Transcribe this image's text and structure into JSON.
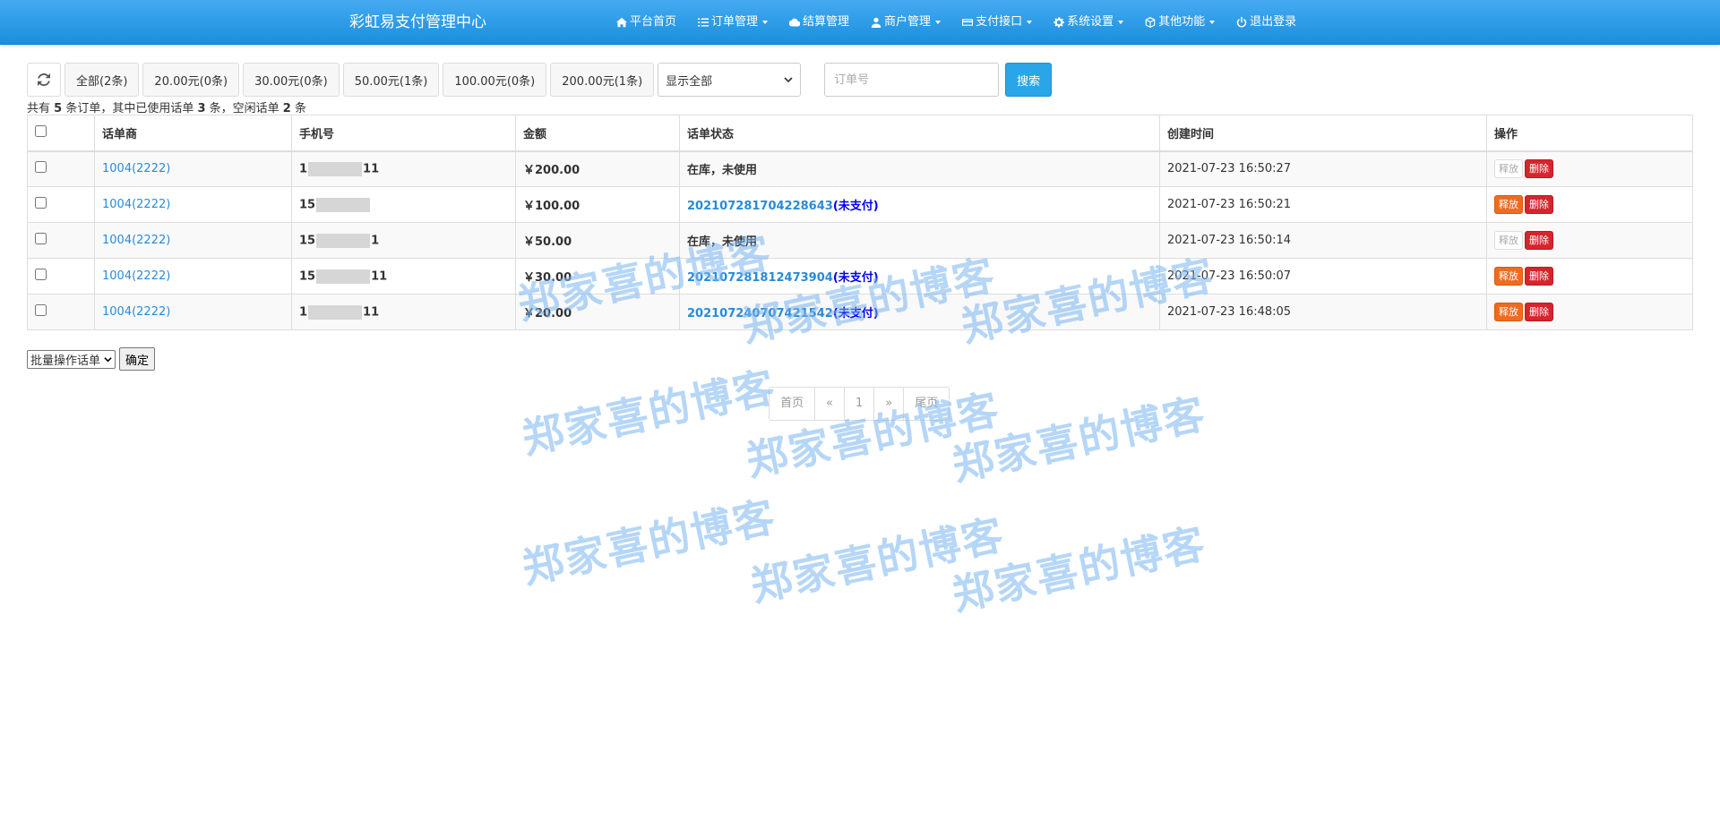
{
  "app": {
    "brand": "彩虹易支付管理中心"
  },
  "nav": {
    "items": [
      {
        "label": "平台首页",
        "icon": "home-icon",
        "dropdown": false
      },
      {
        "label": "订单管理",
        "icon": "list-icon",
        "dropdown": true
      },
      {
        "label": "结算管理",
        "icon": "cloud-icon",
        "dropdown": false
      },
      {
        "label": "商户管理",
        "icon": "user-icon",
        "dropdown": true
      },
      {
        "label": "支付接口",
        "icon": "credit-card-icon",
        "dropdown": true
      },
      {
        "label": "系统设置",
        "icon": "gear-icon",
        "dropdown": true
      },
      {
        "label": "其他功能",
        "icon": "cube-icon",
        "dropdown": true
      },
      {
        "label": "退出登录",
        "icon": "power-icon",
        "dropdown": false
      }
    ]
  },
  "toolbar": {
    "filters": [
      "全部(2条)",
      "20.00元(0条)",
      "30.00元(0条)",
      "50.00元(1条)",
      "100.00元(0条)",
      "200.00元(1条)"
    ],
    "display_select": "显示全部",
    "search_placeholder": "订单号",
    "search_label": "搜索"
  },
  "summary": {
    "prefix": "共有 ",
    "total": "5",
    "mid1": " 条订单，其中已使用话单 ",
    "used": "3",
    "mid2": " 条，空闲话单 ",
    "idle": "2",
    "suffix": " 条"
  },
  "table": {
    "headers": [
      "话单商",
      "手机号",
      "金额",
      "话单状态",
      "创建时间",
      "操作"
    ],
    "rows": [
      {
        "merchant": "1004(2222)",
        "phone_start": "1",
        "phone_end": "11",
        "amount": "￥200.00",
        "status_type": "idle",
        "status": "在库，未使用",
        "order": "",
        "unpaid": "",
        "time": "2021-07-23 16:50:27",
        "release": "释放",
        "release_active": false,
        "delete": "删除"
      },
      {
        "merchant": "1004(2222)",
        "phone_start": "15",
        "phone_end": "",
        "amount": "￥100.00",
        "status_type": "order",
        "status": "",
        "order": "202107281704228643",
        "unpaid": "(未支付)",
        "time": "2021-07-23 16:50:21",
        "release": "释放",
        "release_active": true,
        "delete": "删除"
      },
      {
        "merchant": "1004(2222)",
        "phone_start": "15",
        "phone_end": "1",
        "amount": "￥50.00",
        "status_type": "idle",
        "status": "在库，未使用",
        "order": "",
        "unpaid": "",
        "time": "2021-07-23 16:50:14",
        "release": "释放",
        "release_active": false,
        "delete": "删除"
      },
      {
        "merchant": "1004(2222)",
        "phone_start": "15",
        "phone_end": "11",
        "amount": "￥30.00",
        "status_type": "order",
        "status": "",
        "order": "202107281812473904",
        "unpaid": "(未支付)",
        "time": "2021-07-23 16:50:07",
        "release": "释放",
        "release_active": true,
        "delete": "删除"
      },
      {
        "merchant": "1004(2222)",
        "phone_start": "1",
        "phone_end": "11",
        "amount": "￥20.00",
        "status_type": "order",
        "status": "",
        "order": "202107240707421542",
        "unpaid": "(未支付)",
        "time": "2021-07-23 16:48:05",
        "release": "释放",
        "release_active": true,
        "delete": "删除"
      }
    ]
  },
  "batch": {
    "select_label": "批量操作话单",
    "ok_label": "确定"
  },
  "pagination": {
    "first": "首页",
    "prev": "«",
    "current": "1",
    "next": "»",
    "last": "尾页"
  },
  "watermark": {
    "text": "郑家喜的博客"
  },
  "colors": {
    "nav": "#1a8fdc",
    "accent": "#2aa5e8",
    "release": "#ee6b1f",
    "delete": "#d9232d",
    "link": "#2a8ad8"
  }
}
